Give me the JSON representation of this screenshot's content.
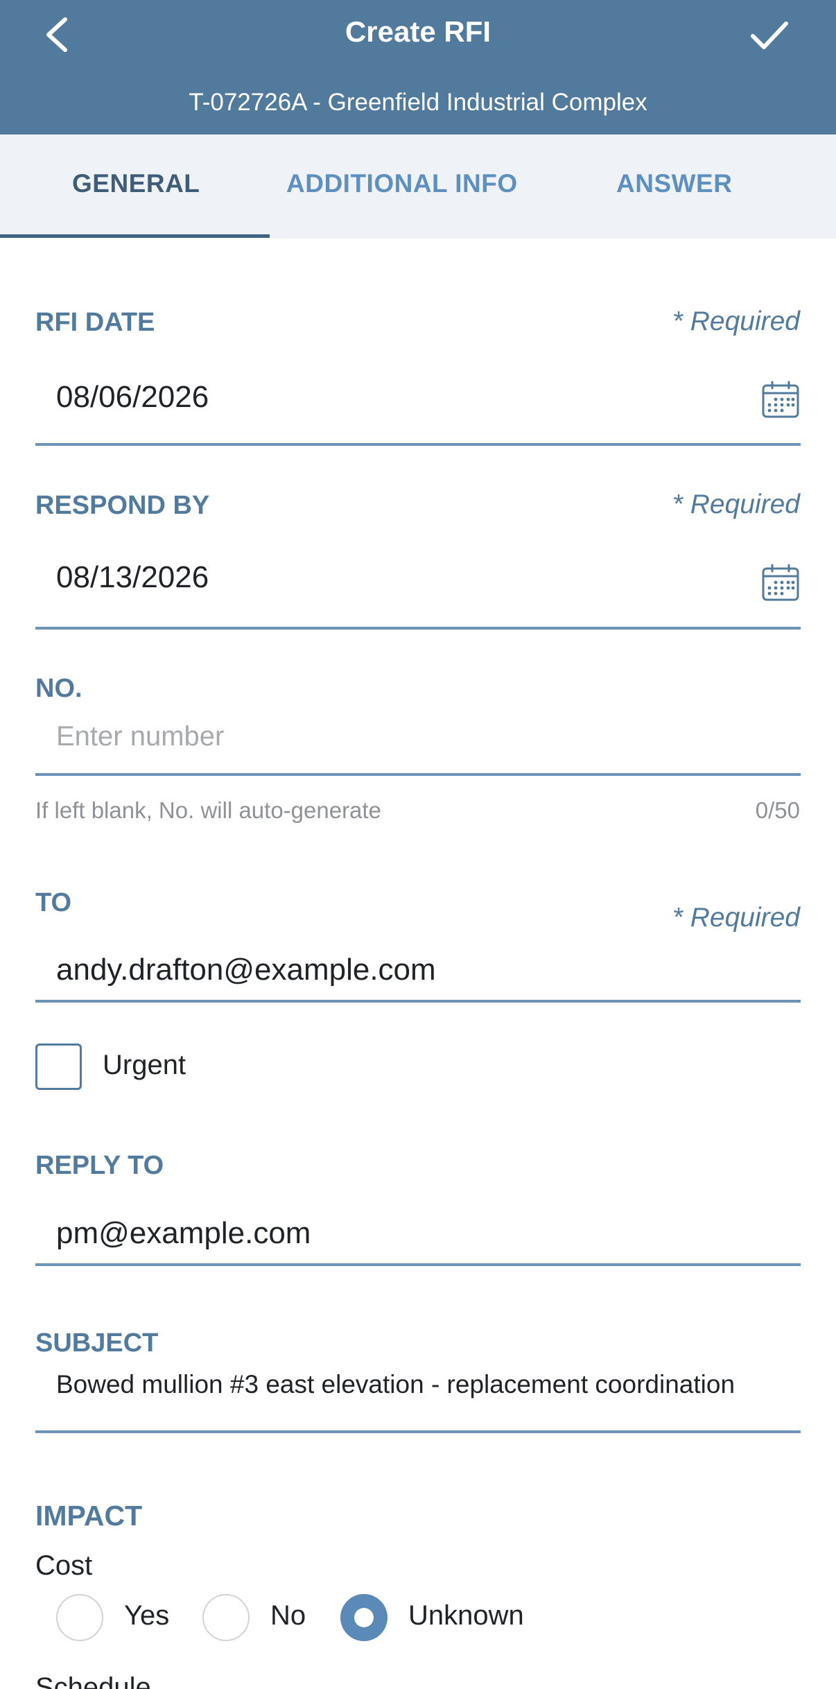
{
  "header": {
    "title": "Create RFI",
    "subtitle": "T-072726A - Greenfield Industrial Complex",
    "back_icon": "chevron-left-icon",
    "save_icon": "checkmark-icon"
  },
  "tabs": [
    {
      "label": "GENERAL",
      "active": true
    },
    {
      "label": "ADDITIONAL INFO",
      "active": false
    },
    {
      "label": "ANSWER",
      "active": false
    }
  ],
  "form": {
    "rfi_date": {
      "label": "RFI DATE",
      "required_text": "* Required",
      "value": "08/06/2026",
      "icon": "calendar-icon"
    },
    "respond_by": {
      "label": "RESPOND BY",
      "required_text": "* Required",
      "value": "08/13/2026",
      "icon": "calendar-icon"
    },
    "number": {
      "label": "NO.",
      "placeholder": "Enter number",
      "helper": "If left blank, No. will auto-generate",
      "counter": "0/50"
    },
    "to": {
      "label": "TO",
      "required_text": "* Required",
      "value": "andy.drafton@example.com"
    },
    "urgent": {
      "label": "Urgent",
      "checked": false
    },
    "reply_to": {
      "label": "REPLY TO",
      "value": "pm@example.com"
    },
    "subject": {
      "label": "SUBJECT",
      "value": "Bowed mullion #3 east elevation - replacement coordination"
    },
    "impact": {
      "title": "IMPACT",
      "cost": {
        "label": "Cost",
        "options": [
          "Yes",
          "No",
          "Unknown"
        ],
        "selected": "Unknown"
      },
      "schedule": {
        "label": "Schedule"
      }
    }
  },
  "colors": {
    "header_bg": "#527a9c",
    "tab_bg": "#eff3f7",
    "accent": "#5b89b8",
    "label": "#527a9c"
  }
}
